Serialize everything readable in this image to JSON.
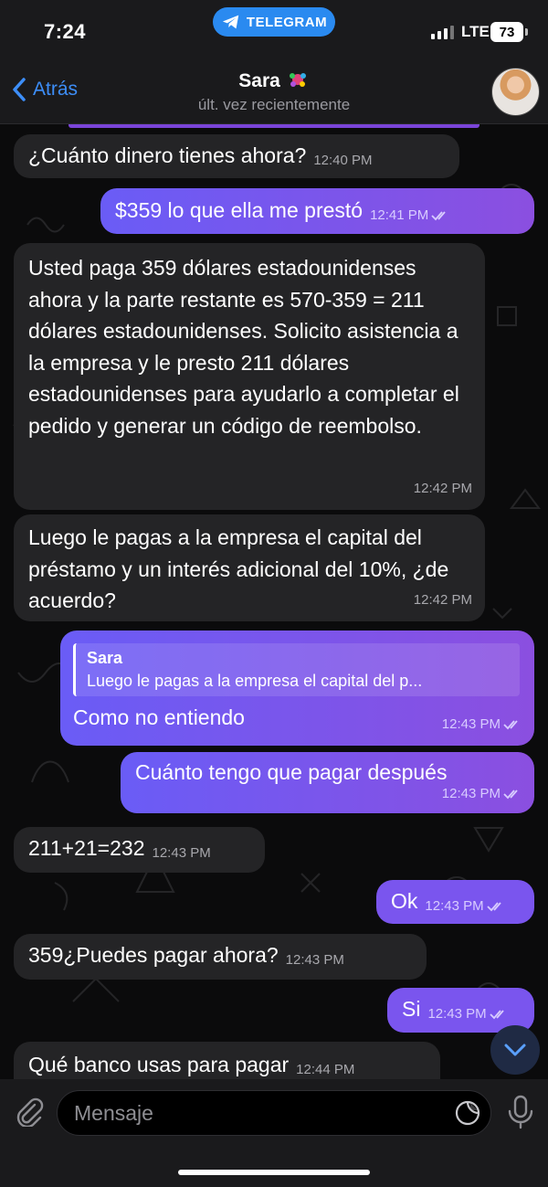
{
  "status_bar": {
    "time": "7:24",
    "app_pill": "TELEGRAM",
    "network": "LTE",
    "battery": "73"
  },
  "header": {
    "back_label": "Atrás",
    "contact_name": "Sara",
    "last_seen": "últ. vez recientemente"
  },
  "messages": [
    {
      "dir": "in",
      "text": "¿Cuánto dinero tienes ahora?",
      "time": "12:40 PM"
    },
    {
      "dir": "out",
      "text": "$359 lo que ella me prestó",
      "time": "12:41 PM"
    },
    {
      "dir": "in",
      "text": "Usted paga 359 dólares estadounidenses ahora y la parte restante es 570-359 = 211 dólares estadounidenses. Solicito asistencia a la empresa y le presto 211 dólares estadounidenses para ayudarlo a completar el pedido y generar un código de reembolso.",
      "time": "12:42 PM"
    },
    {
      "dir": "in",
      "text": "Luego le pagas a la empresa el capital del préstamo y un interés adicional del 10%, ¿de acuerdo?",
      "time": "12:42 PM"
    },
    {
      "dir": "out",
      "reply_name": "Sara",
      "reply_text": "Luego le pagas a la empresa el capital del p...",
      "text": "Como no entiendo",
      "time": "12:43 PM"
    },
    {
      "dir": "out",
      "text": "Cuánto tengo que pagar después",
      "time": "12:43 PM"
    },
    {
      "dir": "in",
      "text": "211+21=232",
      "time": "12:43 PM"
    },
    {
      "dir": "out",
      "text": "Ok",
      "time": "12:43 PM"
    },
    {
      "dir": "in",
      "text": "359¿Puedes pagar ahora?",
      "time": "12:43 PM"
    },
    {
      "dir": "out",
      "text": "Si",
      "time": "12:43 PM"
    },
    {
      "dir": "in",
      "text": "Qué banco usas para pagar",
      "time": "12:44 PM"
    }
  ],
  "composer": {
    "placeholder": "Mensaje"
  },
  "colors": {
    "accent": "#3d8ef8",
    "outgoing_bubble": "#7a55ee",
    "incoming_bubble": "#242426",
    "telegram_pill": "#2a8af0"
  },
  "icons": [
    "telegram-icon",
    "signal-icon",
    "battery-icon",
    "chevron-left-icon",
    "read-checks-icon",
    "chevron-down-icon",
    "paperclip-icon",
    "sticker-icon",
    "microphone-icon"
  ]
}
